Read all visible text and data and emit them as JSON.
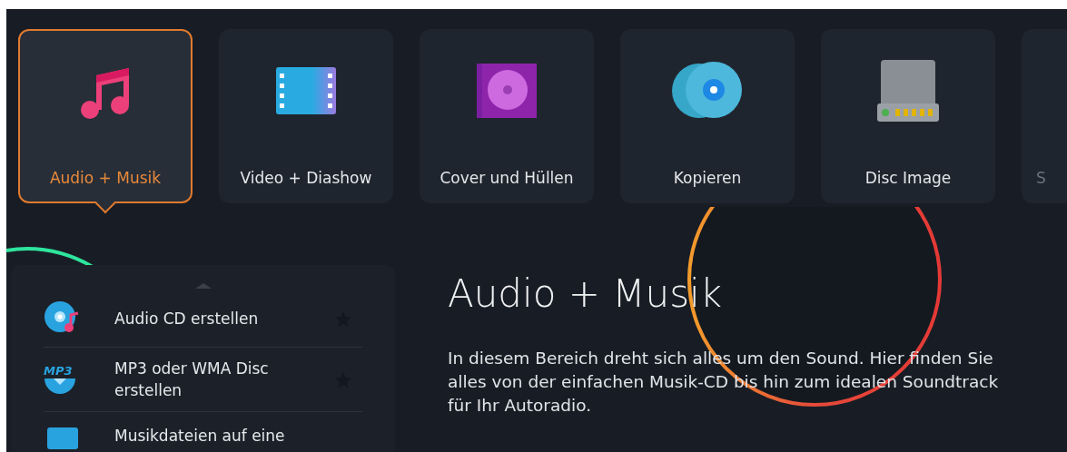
{
  "categories": [
    {
      "label": "Audio + Musik",
      "kind": "music",
      "selected": true
    },
    {
      "label": "Video + Diashow",
      "kind": "film",
      "selected": false
    },
    {
      "label": "Cover und Hüllen",
      "kind": "cover",
      "selected": false
    },
    {
      "label": "Kopieren",
      "kind": "discs",
      "selected": false
    },
    {
      "label": "Disc Image",
      "kind": "drive",
      "selected": false
    },
    {
      "label": "S",
      "kind": "partial",
      "selected": false
    }
  ],
  "menu": {
    "items": [
      {
        "label": "Audio CD erstellen",
        "kind": "audio-cd",
        "favorite": false
      },
      {
        "label": "MP3 oder WMA Disc erstellen",
        "kind": "mp3",
        "badge": "MP3",
        "favorite": false
      },
      {
        "label": "Musikdateien auf eine",
        "kind": "files"
      }
    ]
  },
  "detail": {
    "title": "Audio + Musik",
    "description": "In diesem Bereich dreht sich alles um den Sound. Hier finden Sie alles von der einfachen Musik-CD bis hin zum idealen Soundtrack für Ihr Autoradio."
  }
}
